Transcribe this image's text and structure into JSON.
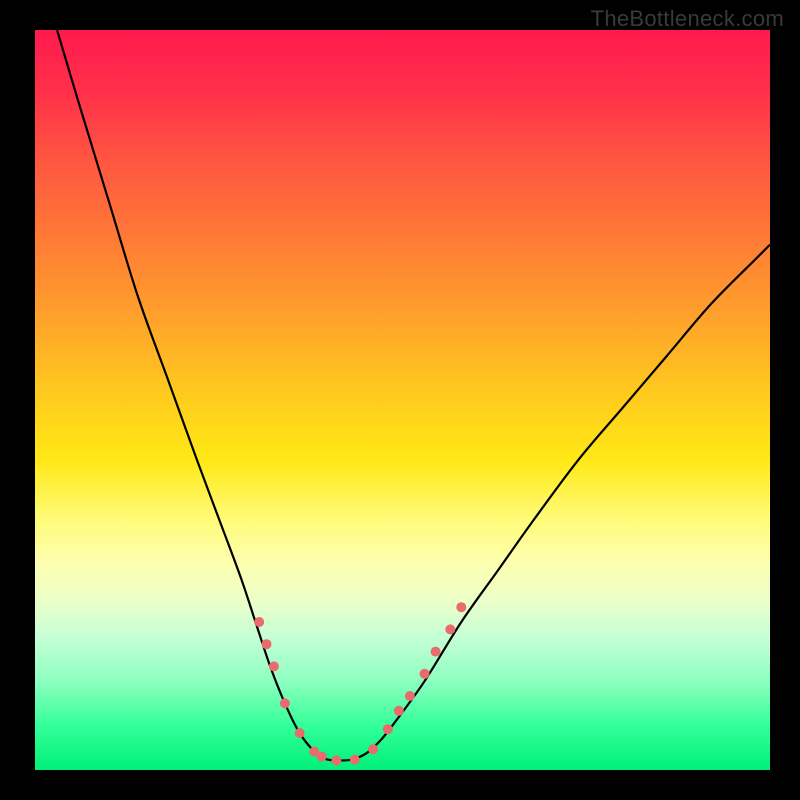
{
  "watermark": "TheBottleneck.com",
  "chart_data": {
    "type": "line",
    "title": "",
    "xlabel": "",
    "ylabel": "",
    "xlim": [
      0,
      100
    ],
    "ylim": [
      0,
      100
    ],
    "series": [
      {
        "name": "bottleneck-curve",
        "x": [
          3,
          6,
          10,
          14,
          18,
          22,
          25,
          28,
          30,
          32,
          34,
          36,
          38,
          39.5,
          41,
          43,
          45,
          47,
          49,
          53,
          58,
          63,
          68,
          74,
          80,
          86,
          92,
          98,
          100
        ],
        "y": [
          100,
          90,
          77,
          64,
          53,
          42,
          34,
          26,
          20,
          14,
          9,
          5,
          2.5,
          1.5,
          1.3,
          1.4,
          2.2,
          4,
          6.5,
          12,
          20,
          27,
          34,
          42,
          49,
          56,
          63,
          69,
          71
        ]
      }
    ],
    "markers": {
      "name": "data-dots",
      "x": [
        30.5,
        31.5,
        32.5,
        34,
        36,
        38,
        39,
        41,
        43.5,
        46,
        48,
        49.5,
        51,
        53,
        54.5,
        56.5,
        58
      ],
      "y": [
        20,
        17,
        14,
        9,
        5,
        2.5,
        1.8,
        1.3,
        1.4,
        2.8,
        5.5,
        8,
        10,
        13,
        16,
        19,
        22
      ],
      "color": "#e86c6c",
      "size": 10
    },
    "gradient_bg": {
      "top": "#ff1a4d",
      "mid": "#ffe815",
      "bottom": "#00f07a"
    }
  }
}
